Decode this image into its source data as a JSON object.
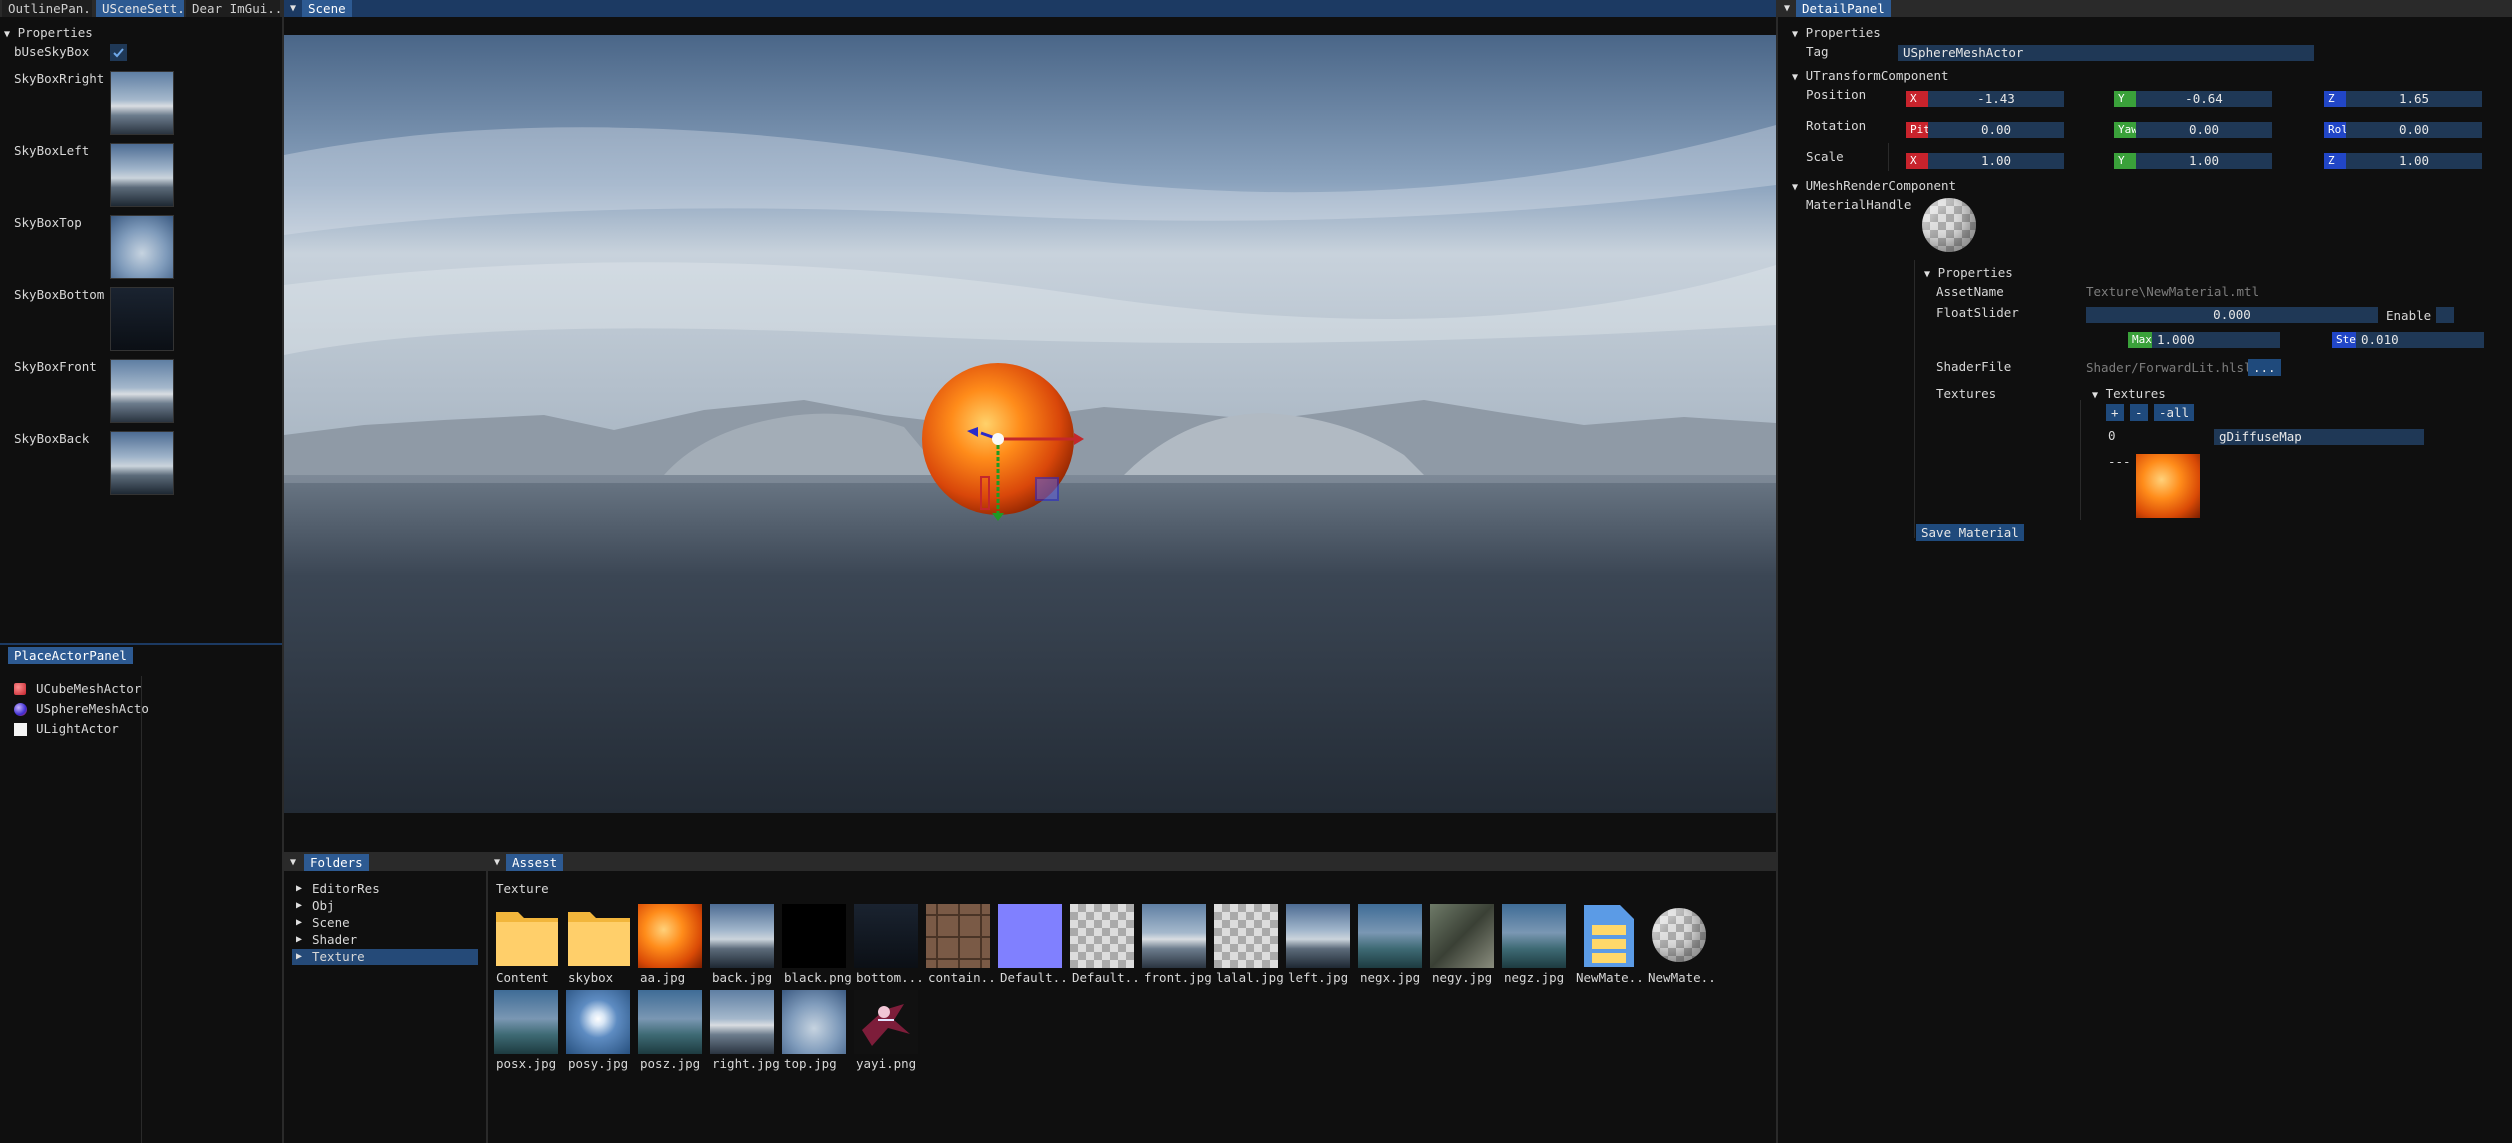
{
  "left_panel": {
    "tabs": [
      "OutlinePan..",
      "USceneSett..",
      "Dear ImGui.."
    ],
    "section_title": "Properties",
    "use_skybox_label": "bUseSkyBox",
    "use_skybox_checked": true,
    "skybox_items": [
      "SkyBoxRright",
      "SkyBoxLeft",
      "SkyBoxTop",
      "SkyBoxBottom",
      "SkyBoxFront",
      "SkyBoxBack"
    ]
  },
  "place_actor_panel": {
    "tab": "PlaceActorPanel",
    "items": [
      "UCubeMeshActor",
      "USphereMeshActo",
      "ULightActor"
    ]
  },
  "scene": {
    "tab": "Scene"
  },
  "folders_panel": {
    "tab": "Folders",
    "items": [
      "EditorRes",
      "Obj",
      "Scene",
      "Shader",
      "Texture"
    ],
    "selected": "Texture"
  },
  "assets_panel": {
    "tab": "Assest",
    "path": "Texture",
    "row1": [
      "Content",
      "skybox",
      "aa.jpg",
      "back.jpg",
      "black.png",
      "bottom...",
      "contain..",
      "Default..",
      "Default..",
      "front.jpg",
      "lalal.jpg",
      "left.jpg",
      "negx.jpg",
      "negy.jpg",
      "negz.jpg",
      "NewMate..",
      "NewMate.."
    ],
    "row2": [
      "posx.jpg",
      "posy.jpg",
      "posz.jpg",
      "right.jpg",
      "top.jpg",
      "yayi.png"
    ]
  },
  "detail_panel": {
    "tab": "DetailPanel",
    "properties_title": "Properties",
    "tag_label": "Tag",
    "tag_value": "USphereMeshActor",
    "transform_title": "UTransformComponent",
    "position_label": "Position",
    "rotation_label": "Rotation",
    "scale_label": "Scale",
    "position": {
      "x_label": "X",
      "x": "-1.43",
      "y_label": "Y",
      "y": "-0.64",
      "z_label": "Z",
      "z": "1.65"
    },
    "rotation": {
      "x_label": "Pit",
      "x": "0.00",
      "y_label": "Yaw",
      "y": "0.00",
      "z_label": "Rol",
      "z": "0.00"
    },
    "scale": {
      "x_label": "X",
      "x": "1.00",
      "y_label": "Y",
      "y": "1.00",
      "z_label": "Z",
      "z": "1.00"
    },
    "mesh_render_title": "UMeshRenderComponent",
    "material_handle_label": "MaterialHandle",
    "mat_properties_title": "Properties",
    "asset_name_label": "AssetName",
    "asset_name_value": "Texture\\NewMaterial.mtl",
    "float_slider_label": "FloatSlider",
    "float_slider_value": "0.000",
    "enable_label": "Enable",
    "max_label": "Max",
    "max_value": "1.000",
    "step_label": "Ste",
    "step_value": "0.010",
    "shader_file_label": "ShaderFile",
    "shader_file_value": "Shader/ForwardLit.hlsl",
    "browse_label": "...",
    "textures_label": "Textures",
    "textures_tree_label": "Textures",
    "add_label": "+",
    "remove_label": "-",
    "remove_all_label": "-all",
    "tex_index": "0",
    "tex_slot_name": "gDiffuseMap",
    "tex_dashes": "---",
    "save_label": "Save Material"
  },
  "colors": {
    "title_active": "#1c3a63",
    "tab_selected": "#2d5a92",
    "field_bg": "#1f3856",
    "axis_x": "#c8232c",
    "axis_y": "#3aa13a",
    "axis_z": "#2146c7"
  }
}
